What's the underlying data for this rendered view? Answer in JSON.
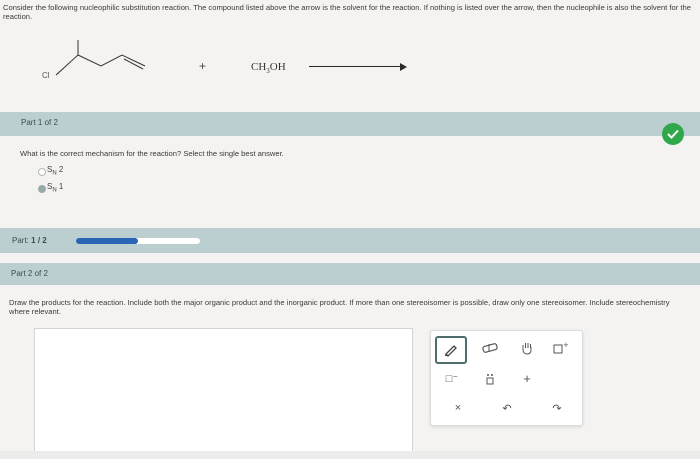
{
  "intro_text": "Consider the following nucleophilic substitution reaction. The compound listed above the arrow is the solvent for the reaction. If nothing is listed over the arrow, then the nucleophile is also the solvent for the reaction.",
  "reaction": {
    "substrate_label": "Cl",
    "plus": "+",
    "reagent": {
      "prefix": "CH",
      "subscript": "3",
      "suffix": "OH"
    }
  },
  "part1": {
    "header": "Part 1 of 2",
    "question": "What is the correct mechanism for the reaction? Select the single best answer.",
    "options": [
      {
        "base": "S",
        "sub": "N",
        "num": "2",
        "selected": false
      },
      {
        "base": "S",
        "sub": "N",
        "num": "1",
        "selected": true
      }
    ],
    "status": "correct"
  },
  "progress": {
    "label": "Part:",
    "value": "1 / 2",
    "fraction": 0.5
  },
  "part2": {
    "header": "Part 2 of 2",
    "question": "Draw the products for the reaction. Include both the major organic product and the inorganic product. If more than one stereoisomer is possible, draw only one stereoisomer. Include stereochemistry where relevant."
  },
  "toolbar": {
    "row1": [
      "pencil-icon",
      "eraser-icon",
      "hand-icon",
      "add-box-icon"
    ],
    "row2": [
      "negative-charge-icon",
      "lone-pair-icon",
      "plus-icon"
    ],
    "row2_labels": [
      "□⁻",
      ":",
      "+"
    ],
    "row3": [
      "clear-icon",
      "undo-icon",
      "redo-icon"
    ],
    "row3_labels": [
      "×",
      "↶",
      "↷"
    ]
  },
  "colors": {
    "bar": "#bccfd0",
    "progress_fill": "#2a64b6",
    "check": "#2ea84a"
  }
}
